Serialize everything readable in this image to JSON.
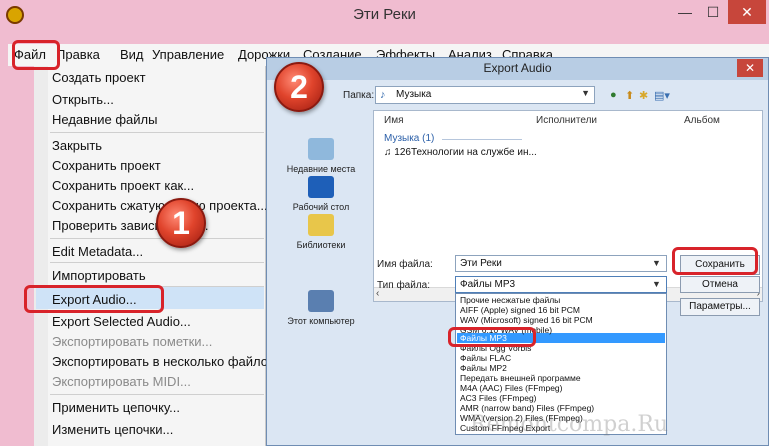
{
  "window": {
    "title": "Эти Реки",
    "minimize": "—",
    "maximize": "☐",
    "close": "✕"
  },
  "menubar": [
    "Файл",
    "Правка",
    "Вид",
    "Управление",
    "Дорожки",
    "Создание",
    "Эффекты",
    "Анализ",
    "Справка"
  ],
  "file_menu": {
    "items": [
      {
        "label": "Создать проект",
        "enabled": true
      },
      {
        "label": "Открыть...",
        "enabled": true
      },
      {
        "label": "Недавние файлы",
        "enabled": true
      },
      {
        "label": "Закрыть",
        "enabled": true
      },
      {
        "label": "Сохранить проект",
        "enabled": true
      },
      {
        "label": "Сохранить проект как...",
        "enabled": true
      },
      {
        "label": "Сохранить сжатую копию проекта...",
        "enabled": true
      },
      {
        "label": "Проверить зависимости...",
        "enabled": true
      },
      {
        "label": "Edit Metadata...",
        "enabled": true
      },
      {
        "label": "Импортировать",
        "enabled": true
      },
      {
        "label": "Export Audio...",
        "enabled": true,
        "highlighted": true
      },
      {
        "label": "Export Selected Audio...",
        "enabled": true
      },
      {
        "label": "Экспортировать пометки...",
        "enabled": false
      },
      {
        "label": "Экспортировать в несколько файлов...",
        "enabled": true
      },
      {
        "label": "Экспортировать MIDI...",
        "enabled": false
      },
      {
        "label": "Применить цепочку...",
        "enabled": true
      },
      {
        "label": "Изменить цепочки...",
        "enabled": true
      }
    ]
  },
  "badges": {
    "one": "1",
    "two": "2"
  },
  "dialog": {
    "title": "Export Audio",
    "close": "✕",
    "folder_label": "Папка:",
    "folder_value": "Музыка",
    "places": [
      "Недавние места",
      "Рабочий стол",
      "Библиотеки",
      "Этот компьютер"
    ],
    "columns": [
      "Имя",
      "Исполнители",
      "Альбом"
    ],
    "group_label": "Музыка (1)",
    "file_row": "126Технологии на службе ин...",
    "filename_label": "Имя файла:",
    "filename_value": "Эти Реки",
    "filetype_label": "Тип файла:",
    "filetype_value": "Файлы MP3",
    "save_button": "Сохранить",
    "cancel_button": "Отмена",
    "options_button": "Параметры...",
    "file_types": [
      "Прочие несжатые файлы",
      "AIFF (Apple) signed 16 bit PCM",
      "WAV (Microsoft) signed 16 bit PCM",
      "GSM 6.10 WAV (mobile)",
      "Файлы MP3",
      "Файлы Ogg Vorbis",
      "Файлы FLAC",
      "Файлы MP2",
      "Передать внешней программе",
      "M4A (AAC) Files (FFmpeg)",
      "AC3 Files (FFmpeg)",
      "AMR (narrow band) Files (FFmpeg)",
      "WMA (version 2) Files (FFmpeg)",
      "Custom FFmpeg Export"
    ],
    "selected_type_index": 4
  },
  "watermark": "Remontcompa.Ru",
  "colors": {
    "highlight_red": "#d8232a",
    "selection_blue": "#3399ff",
    "title_pink": "#f0bcd0"
  }
}
